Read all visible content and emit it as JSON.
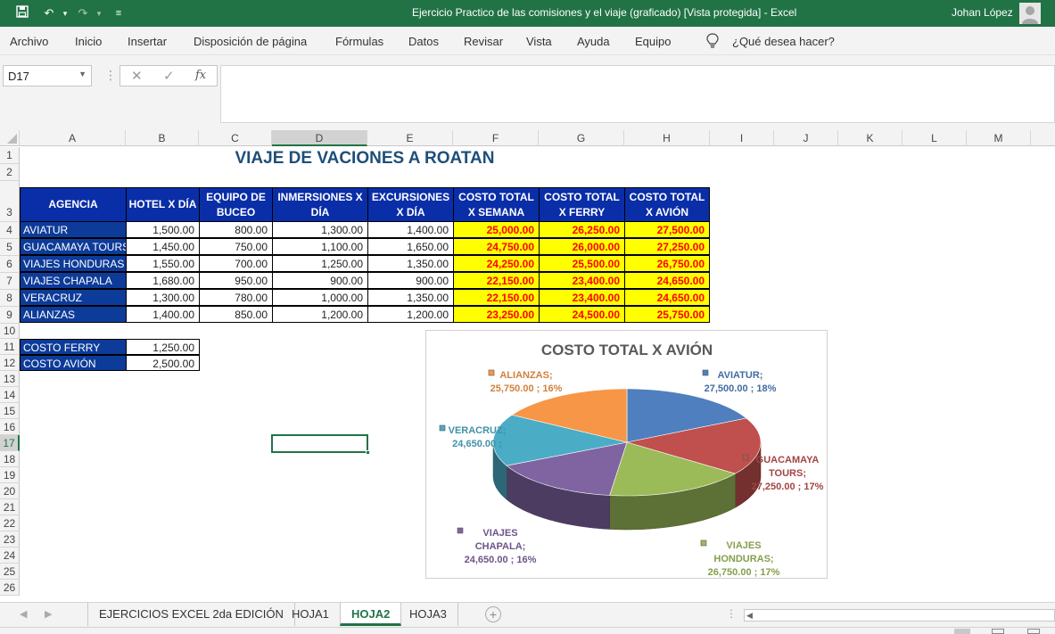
{
  "app": {
    "title": "Ejercicio Practico de las comisiones y el viaje (graficado)  [Vista protegida]  -  Excel",
    "user": "Johan López"
  },
  "ribbon": {
    "tabs": [
      "Archivo",
      "Inicio",
      "Insertar",
      "Disposición de página",
      "Fórmulas",
      "Datos",
      "Revisar",
      "Vista",
      "Ayuda",
      "Equipo"
    ],
    "tell_me": "¿Qué desea hacer?"
  },
  "formula_bar": {
    "name_box": "D17",
    "fx": "fx",
    "value": ""
  },
  "columns": [
    "A",
    "B",
    "C",
    "D",
    "E",
    "F",
    "G",
    "H",
    "I",
    "J",
    "K",
    "L",
    "M"
  ],
  "rows": [
    "1",
    "2",
    "3",
    "4",
    "5",
    "6",
    "7",
    "8",
    "9",
    "10",
    "11",
    "12",
    "13",
    "14",
    "15",
    "16",
    "17",
    "18",
    "19",
    "20",
    "21",
    "22",
    "23",
    "24",
    "25",
    "26"
  ],
  "sheet": {
    "title": "VIAJE DE VACIONES A ROATAN",
    "headers": [
      "AGENCIA",
      "HOTEL X DÍA",
      "EQUIPO DE BUCEO",
      "INMERSIONES X DÍA",
      "EXCURSIONES X DÍA",
      "COSTO TOTAL X SEMANA",
      "COSTO TOTAL X FERRY",
      "COSTO TOTAL X AVIÓN"
    ],
    "table": [
      [
        "AVIATUR",
        "1,500.00",
        "800.00",
        "1,300.00",
        "1,400.00",
        "25,000.00",
        "26,250.00",
        "27,500.00"
      ],
      [
        "GUACAMAYA TOURS",
        "1,450.00",
        "750.00",
        "1,100.00",
        "1,650.00",
        "24,750.00",
        "26,000.00",
        "27,250.00"
      ],
      [
        "VIAJES HONDURAS",
        "1,550.00",
        "700.00",
        "1,250.00",
        "1,350.00",
        "24,250.00",
        "25,500.00",
        "26,750.00"
      ],
      [
        "VIAJES CHAPALA",
        "1,680.00",
        "950.00",
        "900.00",
        "900.00",
        "22,150.00",
        "23,400.00",
        "24,650.00"
      ],
      [
        "VERACRUZ",
        "1,300.00",
        "780.00",
        "1,000.00",
        "1,350.00",
        "22,150.00",
        "23,400.00",
        "24,650.00"
      ],
      [
        "ALIANZAS",
        "1,400.00",
        "850.00",
        "1,200.00",
        "1,200.00",
        "23,250.00",
        "24,500.00",
        "25,750.00"
      ]
    ],
    "extra": [
      [
        "COSTO FERRY",
        "1,250.00"
      ],
      [
        "COSTO AVIÓN",
        "2,500.00"
      ]
    ]
  },
  "chart_data": {
    "type": "pie",
    "title": "COSTO TOTAL X AVIÓN",
    "categories": [
      "AVIATUR",
      "GUACAMAYA TOURS",
      "VIAJES HONDURAS",
      "VIAJES CHAPALA",
      "VERACRUZ",
      "ALIANZAS"
    ],
    "values": [
      27500,
      27250,
      26750,
      24650,
      24650,
      25750
    ],
    "labels": [
      [
        "AVIATUR;",
        "27,500.00 ; 18%"
      ],
      [
        "GUACAMAYA",
        "TOURS;",
        "27,250.00 ; 17%"
      ],
      [
        "VIAJES",
        "HONDURAS;",
        "26,750.00 ; 17%"
      ],
      [
        "VIAJES",
        "CHAPALA;",
        "24,650.00 ; 16%"
      ],
      [
        "VERACRUZ;",
        "24,650.00 ;"
      ],
      [
        "ALIANZAS;",
        "25,750.00 ; 16%"
      ]
    ],
    "colors": [
      "#4f7fbe",
      "#c0504d",
      "#9bbb59",
      "#8064a2",
      "#4bacc6",
      "#f79646"
    ]
  },
  "sheet_tabs": [
    "EJERCICIOS EXCEL 2da EDICIÓN",
    "HOJA1",
    "HOJA2",
    "HOJA3"
  ],
  "active_tab": "HOJA2",
  "colors": {
    "excel_green": "#217346",
    "header_blue": "#0a2ea8",
    "label_blue": "#0d3b99",
    "highlight_yellow": "#ffff00",
    "highlight_red": "#ff0000"
  }
}
